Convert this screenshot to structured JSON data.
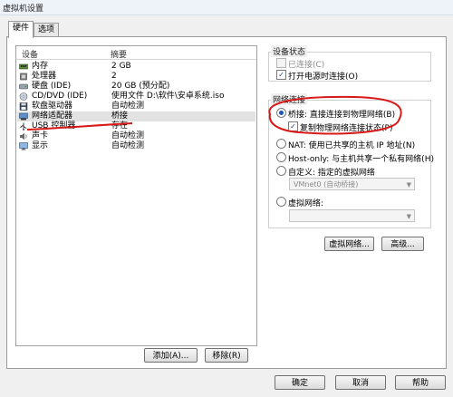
{
  "window": {
    "title": "虚拟机设置"
  },
  "tabs": [
    {
      "label": "硬件"
    },
    {
      "label": "选项"
    }
  ],
  "device_list": {
    "headers": {
      "device": "设备",
      "summary": "摘要"
    },
    "rows": [
      {
        "icon": "memory-icon",
        "device": "内存",
        "summary": "2 GB"
      },
      {
        "icon": "cpu-icon",
        "device": "处理器",
        "summary": "2"
      },
      {
        "icon": "hard-disk-icon",
        "device": "硬盘 (IDE)",
        "summary": "20 GB (预分配)"
      },
      {
        "icon": "cd-dvd-icon",
        "device": "CD/DVD (IDE)",
        "summary": "使用文件 D:\\软件\\安卓系统.iso"
      },
      {
        "icon": "floppy-icon",
        "device": "软盘驱动器",
        "summary": "自动检测"
      },
      {
        "icon": "network-adapter-icon",
        "device": "网络适配器",
        "summary": "桥接"
      },
      {
        "icon": "usb-icon",
        "device": "USB 控制器",
        "summary": "存在"
      },
      {
        "icon": "sound-card-icon",
        "device": "声卡",
        "summary": "自动检测"
      },
      {
        "icon": "display-icon",
        "device": "显示",
        "summary": "自动检测"
      }
    ]
  },
  "device_status": {
    "label": "设备状态",
    "connected": {
      "label": "已连接(C)",
      "checked": false,
      "disabled": true
    },
    "connect_at_power_on": {
      "label": "打开电源时连接(O)",
      "checked": true
    }
  },
  "network_connection": {
    "label": "网络连接",
    "bridged": {
      "label": "桥接: 直接连接到物理网络(B)",
      "selected": true
    },
    "replicate_state": {
      "label": "复制物理网络连接状态(P)",
      "checked": true
    },
    "nat": {
      "label": "NAT: 使用已共享的主机 IP 地址(N)",
      "selected": false
    },
    "host_only": {
      "label": "Host-only: 与主机共享一个私有网络(H)",
      "selected": false
    },
    "custom": {
      "label": "自定义: 指定的虚拟网络",
      "selected": false,
      "select_value": "VMnet0 (自动桥接)"
    },
    "lan_segment": {
      "label": "虚拟网络:",
      "selected": false,
      "select_value": ""
    }
  },
  "buttons": {
    "virtual_network": "虚拟网络...",
    "advanced": "高级...",
    "add": "添加(A)...",
    "remove": "移除(R)",
    "ok": "确定",
    "cancel": "取消",
    "help": "帮助"
  },
  "annotation_color": "#d91818"
}
